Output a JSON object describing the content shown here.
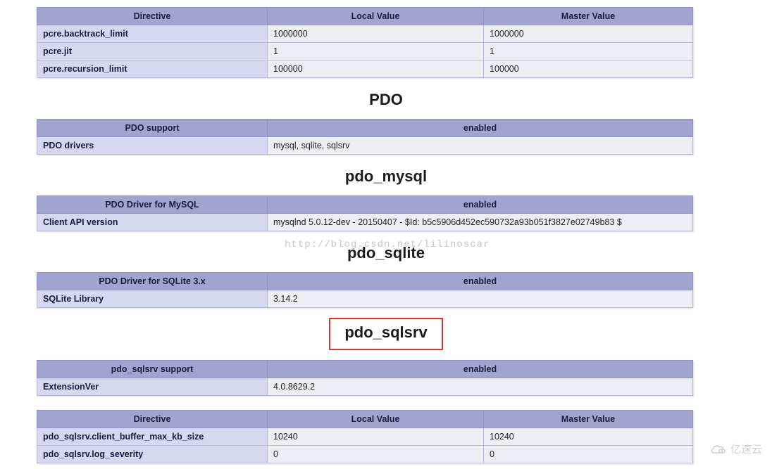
{
  "pcre_table": {
    "headers": [
      "Directive",
      "Local Value",
      "Master Value"
    ],
    "rows": [
      {
        "name": "pcre.backtrack_limit",
        "local": "1000000",
        "master": "1000000"
      },
      {
        "name": "pcre.jit",
        "local": "1",
        "master": "1"
      },
      {
        "name": "pcre.recursion_limit",
        "local": "100000",
        "master": "100000"
      }
    ]
  },
  "pdo": {
    "heading": "PDO",
    "headers": [
      "PDO support",
      "enabled"
    ],
    "rows": [
      {
        "k": "PDO drivers",
        "v": "mysql, sqlite, sqlsrv"
      }
    ]
  },
  "pdo_mysql": {
    "heading": "pdo_mysql",
    "headers": [
      "PDO Driver for MySQL",
      "enabled"
    ],
    "rows": [
      {
        "k": "Client API version",
        "v": "mysqlnd 5.0.12-dev - 20150407 - $Id: b5c5906d452ec590732a93b051f3827e02749b83 $"
      }
    ]
  },
  "pdo_sqlite": {
    "heading": "pdo_sqlite",
    "headers": [
      "PDO Driver for SQLite 3.x",
      "enabled"
    ],
    "rows": [
      {
        "k": "SQLite Library",
        "v": "3.14.2"
      }
    ]
  },
  "pdo_sqlsrv": {
    "heading": "pdo_sqlsrv",
    "support_headers": [
      "pdo_sqlsrv support",
      "enabled"
    ],
    "support_rows": [
      {
        "k": "ExtensionVer",
        "v": "4.0.8629.2"
      }
    ],
    "dir_headers": [
      "Directive",
      "Local Value",
      "Master Value"
    ],
    "dir_rows": [
      {
        "name": "pdo_sqlsrv.client_buffer_max_kb_size",
        "local": "10240",
        "master": "10240"
      },
      {
        "name": "pdo_sqlsrv.log_severity",
        "local": "0",
        "master": "0"
      }
    ]
  },
  "watermark_blog": "http://blog.csdn.net/lilinoscar",
  "watermark_brand": "亿速云"
}
